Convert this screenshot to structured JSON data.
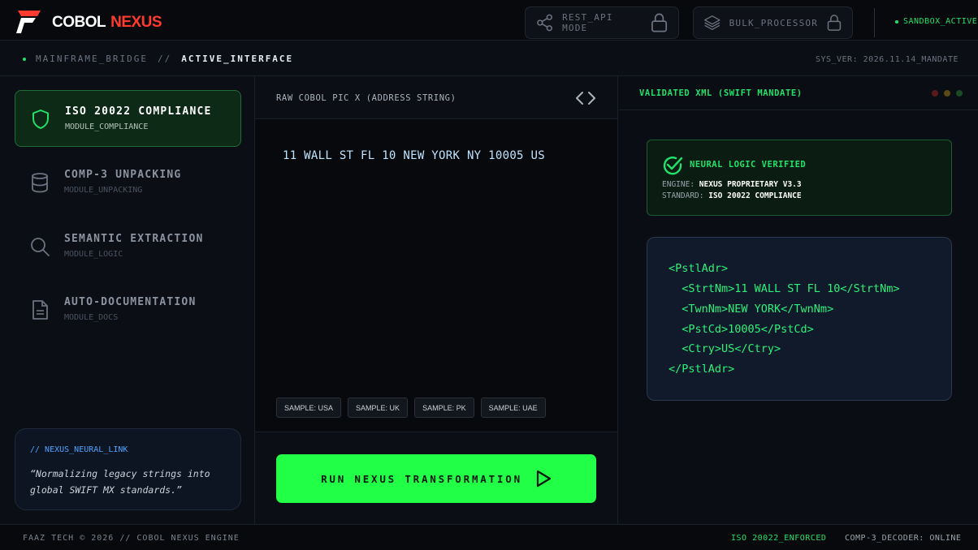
{
  "brand": {
    "name_white": "COBOL",
    "name_red": "NEXUS"
  },
  "header": {
    "rest_api_label": "REST_API MODE",
    "bulk_label": "BULK_PROCESSOR",
    "sandbox_label": "SANDBOX_ACTIVE"
  },
  "breadcrumb": {
    "root": "MAINFRAME_BRIDGE",
    "sep": "//",
    "active": "ACTIVE_INTERFACE"
  },
  "sys_ver": "SYS_VER: 2026.11.14_MANDATE",
  "sidebar": {
    "modules": [
      {
        "title": "ISO 20022 COMPLIANCE",
        "sub": "MODULE_COMPLIANCE",
        "icon": "shield-icon",
        "active": true
      },
      {
        "title": "COMP-3 UNPACKING",
        "sub": "MODULE_UNPACKING",
        "icon": "database-icon",
        "active": false
      },
      {
        "title": "SEMANTIC EXTRACTION",
        "sub": "MODULE_LOGIC",
        "icon": "search-icon",
        "active": false
      },
      {
        "title": "AUTO-DOCUMENTATION",
        "sub": "MODULE_DOCS",
        "icon": "document-icon",
        "active": false
      }
    ],
    "neural_link": {
      "heading": "// NEXUS_NEURAL_LINK",
      "quote": "“Normalizing legacy strings into global SWIFT MX standards.”"
    }
  },
  "input_panel": {
    "title": "RAW COBOL PIC X (ADDRESS STRING)",
    "value": "11 WALL ST FL 10 NEW YORK NY 10005 US",
    "samples": [
      "SAMPLE: USA",
      "SAMPLE: UK",
      "SAMPLE: PK",
      "SAMPLE: UAE"
    ],
    "run_label": "RUN NEXUS TRANSFORMATION"
  },
  "output_panel": {
    "title": "VALIDATED XML (SWIFT MANDATE)",
    "verified": {
      "title": "NEURAL LOGIC VERIFIED",
      "engine_label": "ENGINE:",
      "engine_value": "NEXUS PROPRIETARY V3.3",
      "standard_label": "STANDARD:",
      "standard_value": "ISO 20022 COMPLIANCE"
    },
    "xml_lines": [
      "<PstlAdr>",
      "  <StrtNm>11 WALL ST FL 10</StrtNm>",
      "  <TwnNm>NEW YORK</TwnNm>",
      "  <PstCd>10005</PstCd>",
      "  <Ctry>US</Ctry>",
      "</PstlAdr>"
    ]
  },
  "footer": {
    "left": "FAAZ TECH © 2026 // COBOL NEXUS ENGINE",
    "status_1": "ISO 20022_ENFORCED",
    "status_2": "COMP-3_DECODER: ONLINE"
  },
  "colors": {
    "accent_green": "#21ff47",
    "brand_red": "#ff3b2f",
    "link_blue": "#4aa3ff"
  }
}
